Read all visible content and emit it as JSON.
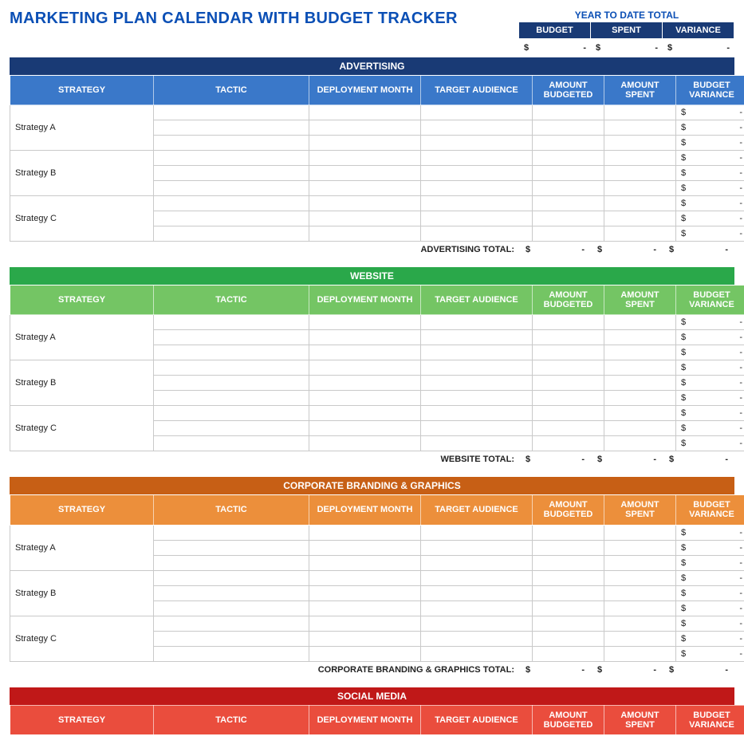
{
  "page_title": "MARKETING PLAN CALENDAR WITH BUDGET TRACKER",
  "ytd": {
    "title": "YEAR TO DATE TOTAL",
    "headers": {
      "budget": "BUDGET",
      "spent": "SPENT",
      "variance": "VARIANCE"
    },
    "values": {
      "budget": {
        "sym": "$",
        "val": "-"
      },
      "spent": {
        "sym": "$",
        "val": "-"
      },
      "variance": {
        "sym": "$",
        "val": "-"
      }
    }
  },
  "columns": {
    "strategy": "STRATEGY",
    "tactic": "TACTIC",
    "deployment": "DEPLOYMENT MONTH",
    "audience": "TARGET AUDIENCE",
    "budgeted": "AMOUNT BUDGETED",
    "spent": "AMOUNT SPENT",
    "variance": "BUDGET VARIANCE"
  },
  "money_cell": {
    "sym": "$",
    "val": "-"
  },
  "sections": {
    "advertising": {
      "title": "ADVERTISING",
      "total_label": "ADVERTISING TOTAL:",
      "strategies": [
        "Strategy A",
        "Strategy B",
        "Strategy C"
      ]
    },
    "website": {
      "title": "WEBSITE",
      "total_label": "WEBSITE TOTAL:",
      "strategies": [
        "Strategy A",
        "Strategy B",
        "Strategy C"
      ]
    },
    "branding": {
      "title": "CORPORATE BRANDING & GRAPHICS",
      "total_label": "CORPORATE BRANDING & GRAPHICS TOTAL:",
      "strategies": [
        "Strategy A",
        "Strategy B",
        "Strategy C"
      ]
    },
    "social": {
      "title": "SOCIAL MEDIA"
    }
  }
}
